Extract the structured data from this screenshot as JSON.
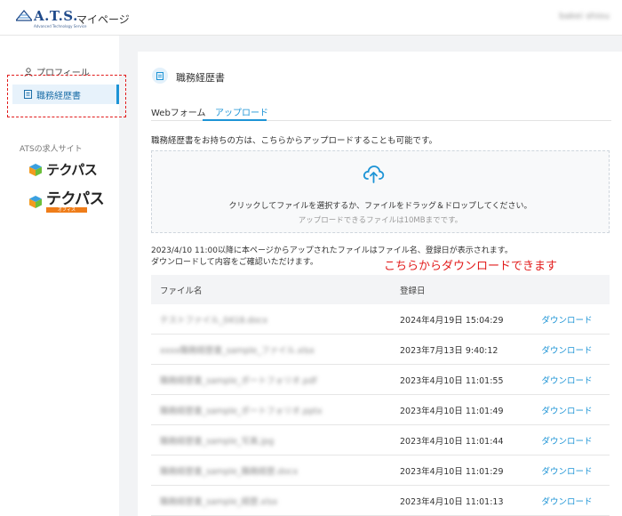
{
  "header": {
    "logo_text": "A.T.S.",
    "logo_subtitle": "Advanced Technology Service",
    "page_name": "マイページ",
    "user_name": "bakei shiou"
  },
  "sidebar": {
    "profile_label": "プロフィール",
    "resume_label": "職務経歴書",
    "job_sites_heading": "ATSの求人サイト",
    "brand1": "テクパス",
    "brand2": "テクパス",
    "brand2_tag": "オフィス"
  },
  "main": {
    "title": "職務経歴書",
    "tabs": [
      {
        "label": "Webフォーム",
        "active": false
      },
      {
        "label": "アップロード",
        "active": true
      }
    ],
    "intro": "職務経歴書をお持ちの方は、こちらからアップロードすることも可能です。",
    "dropzone": {
      "main_text": "クリックしてファイルを選択するか、ファイルをドラッグ＆ドロップしてください。",
      "sub_text": "アップロードできるファイルは10MBまでです。"
    },
    "notice_line1": "2023/4/10 11:00以降に本ページからアップされたファイルはファイル名、登録日が表示されます。",
    "notice_line2": "ダウンロードして内容をご確認いただけます。",
    "callout": "こちらからダウンロードできます"
  },
  "table": {
    "headers": {
      "name": "ファイル名",
      "date": "登録日"
    },
    "rows": [
      {
        "name": "テストファイル_0418.docx",
        "date": "2024年4月19日 15:04:29",
        "action": "ダウンロード"
      },
      {
        "name": "xxxx職務経歴書_sample_ファイル.xlsx",
        "date": "2023年7月13日 9:40:12",
        "action": "ダウンロード"
      },
      {
        "name": "職務経歴書_sample_ポートフォリオ.pdf",
        "date": "2023年4月10日 11:01:55",
        "action": "ダウンロード"
      },
      {
        "name": "職務経歴書_sample_ポートフォリオ.pptx",
        "date": "2023年4月10日 11:01:49",
        "action": "ダウンロード"
      },
      {
        "name": "職務経歴書_sample_写真.jpg",
        "date": "2023年4月10日 11:01:44",
        "action": "ダウンロード"
      },
      {
        "name": "職務経歴書_sample_職務経歴.docx",
        "date": "2023年4月10日 11:01:29",
        "action": "ダウンロード"
      },
      {
        "name": "職務経歴書_sample_経歴.xlsx",
        "date": "2023年4月10日 11:01:13",
        "action": "ダウンロード"
      }
    ]
  },
  "colors": {
    "accent": "#1d94d6",
    "annotation": "#e21c1c",
    "brand_orange": "#ef7d1a"
  }
}
